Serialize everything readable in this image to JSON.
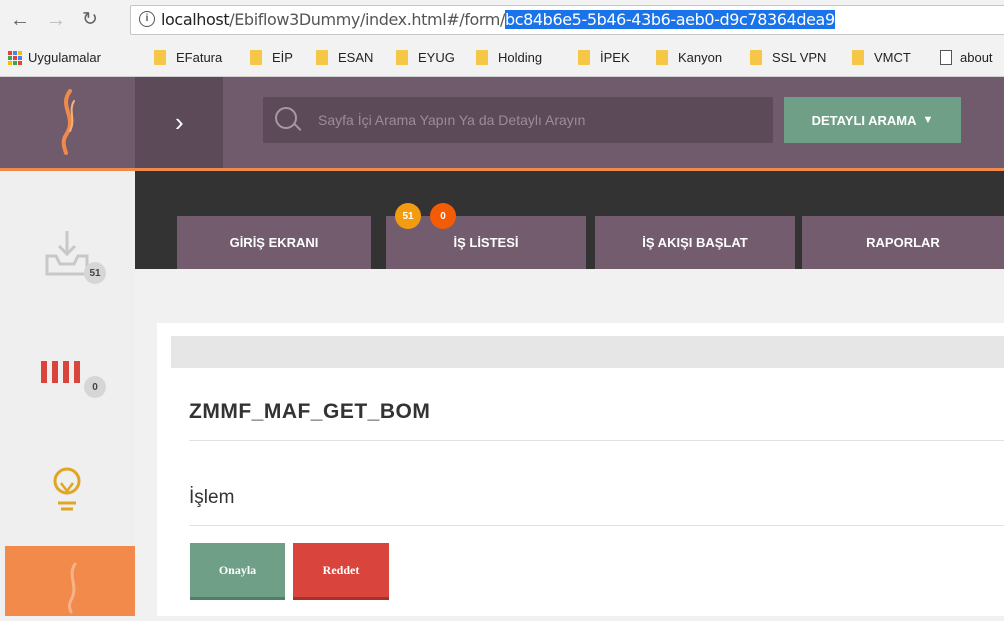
{
  "browser": {
    "url_host": "localhost",
    "url_path": "/Ebiflow3Dummy/index.html#/form/",
    "url_selected": "bc84b6e5-5b46-43b6-aeb0-d9c78364dea9",
    "bookmarks": {
      "apps_label": "Uygulamalar",
      "items": [
        "EFatura",
        "EİP",
        "ESAN",
        "EYUG",
        "Holding",
        "İPEK",
        "Kanyon",
        "SSL VPN",
        "VMCT"
      ],
      "page_label": "about"
    }
  },
  "header": {
    "search_placeholder": "Sayfa İçi Arama Yapın Ya da Detaylı Arayın",
    "detailed_search_label": "DETAYLI ARAMA"
  },
  "sidebar": {
    "inbox_badge": "51",
    "bars_badge": "0"
  },
  "tabs": [
    {
      "label": "GİRİŞ EKRANI"
    },
    {
      "label": "İŞ LİSTESİ"
    },
    {
      "label": "İŞ AKIŞI BAŞLAT"
    },
    {
      "label": "RAPORLAR"
    }
  ],
  "tab_badges": {
    "orange": "51",
    "red": "0"
  },
  "form": {
    "title": "ZMMF_MAF_GET_BOM",
    "section_label": "İşlem",
    "approve_label": "Onayla",
    "reject_label": "Reddet"
  },
  "colors": {
    "brand": "#705b6c",
    "accent": "#f08a4b",
    "approve": "#6fa087",
    "reject": "#d9443d"
  }
}
